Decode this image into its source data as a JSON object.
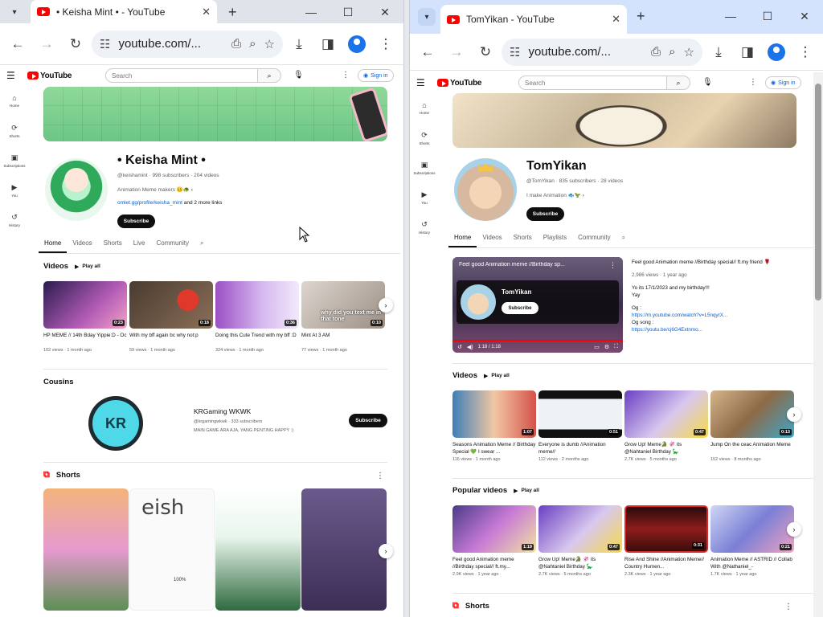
{
  "left_window": {
    "tab_title": "• Keisha Mint • - YouTube",
    "url": "youtube.com/...",
    "yt": {
      "search_placeholder": "Search",
      "signin_label": "Sign in",
      "guide": [
        "Home",
        "Shorts",
        "Subscriptions",
        "You",
        "History"
      ],
      "channel": {
        "name": "• Keisha Mint •",
        "handle_meta": "@keishamint · 998 subscribers · 204 videos",
        "description": "Animation Meme makers 🥴🐢",
        "link_url": "omlet.gg/profile/keisha_mint",
        "link_more": " and 2 more links",
        "subscribe_label": "Subscribe",
        "tabs": [
          "Home",
          "Videos",
          "Shorts",
          "Live",
          "Community"
        ]
      },
      "videos_section": {
        "title": "Videos",
        "play_all": "Play all",
        "items": [
          {
            "title": "HP MEME // 14th Bday Yippie:D - Oc",
            "meta": "102 views · 1 month ago",
            "duration": "0:23"
          },
          {
            "title": "With my bff again bc why not:p",
            "meta": "59 views · 1 month ago",
            "duration": "0:18"
          },
          {
            "title": "Doing this Cute Trend with my bff :D",
            "meta": "324 views · 1 month ago",
            "duration": "0:36"
          },
          {
            "title": "Mint At 3 AM",
            "meta": "77 views · 1 month ago",
            "duration": "0:10"
          }
        ],
        "thumb_overlay_text": "why did you text me in that tone"
      },
      "cousins": {
        "title": "Cousins",
        "name": "KRGaming WKWK",
        "meta": "@krgamingwkwk · 333 subscribers",
        "desc": "MAIN GAME ARA AJA, YANG PENTING HAPPY :)",
        "subscribe_label": "Subscribe",
        "logo_text": "KR"
      },
      "shorts": {
        "title": "Shorts",
        "short2_text": "eish",
        "short2_percent": "100%"
      }
    }
  },
  "right_window": {
    "tab_title": "TomYikan - YouTube",
    "url": "youtube.com/...",
    "yt": {
      "search_placeholder": "Search",
      "signin_label": "Sign in",
      "guide": [
        "Home",
        "Shorts",
        "Subscriptions",
        "You",
        "History"
      ],
      "channel": {
        "name": "TomYikan",
        "handle_meta": "@TomYikan · 835 subscribers · 28 videos",
        "description": "I make Animation 🐟🦖",
        "subscribe_label": "Subscribe",
        "tabs": [
          "Home",
          "Videos",
          "Shorts",
          "Playlists",
          "Community"
        ]
      },
      "featured": {
        "player_title": "Feel good Animation meme //Birthday sp...",
        "player_channel": "TomYikan",
        "player_subscribe": "Subscribe",
        "time": "1:18 / 1:18",
        "title": "Feel good Animation meme //Birthday special// ft.my friend 🌹",
        "meta": "2,986 views · 1 year ago",
        "line1": "Yo its 17/1/2023 and my birthday!!!",
        "line2": "Yay",
        "line3": "Og :",
        "link1": "https://m.youtube.com/watch?v=L5nqyrX...",
        "line4": "Og song :",
        "link2": "https://youtu.be/cj6G4Extnmo..."
      },
      "videos_section": {
        "title": "Videos",
        "play_all": "Play all",
        "items": [
          {
            "title": "Seasons Animation Meme // Birthday Special 💚 I swear ...",
            "meta": "116 views · 1 month ago",
            "duration": "1:07"
          },
          {
            "title": "Everyone is dumb //Animation meme//",
            "meta": "112 views · 2 months ago",
            "duration": "0:51"
          },
          {
            "title": "Grow Up! Meme🐊 🦑 its @Nahtaniel Birthday 🦕",
            "meta": "2.7K views · 5 months ago",
            "duration": "0:47"
          },
          {
            "title": "Jump On the ceac Animation Meme",
            "meta": "152 views · 8 months ago",
            "duration": "0:13"
          }
        ]
      },
      "popular_section": {
        "title": "Popular videos",
        "play_all": "Play all",
        "items": [
          {
            "title": "Feel good Animation meme //Birthday special// ft.my...",
            "meta": "2.9K views · 1 year ago",
            "duration": "1:19"
          },
          {
            "title": "Grow Up! Meme🐊 🦑 its @Nahtaniel Birthday 🦕",
            "meta": "2.7K views · 5 months ago",
            "duration": "0:47"
          },
          {
            "title": "Rise And Shine //Animation Meme// Country Humen...",
            "meta": "2.3K views · 1 year ago",
            "duration": "0:31"
          },
          {
            "title": "Animation Meme // ASTRID // Collab With @Nathaniel_-",
            "meta": "1.7K views · 1 year ago",
            "duration": "0:21"
          }
        ]
      },
      "shorts_title": "Shorts"
    }
  }
}
